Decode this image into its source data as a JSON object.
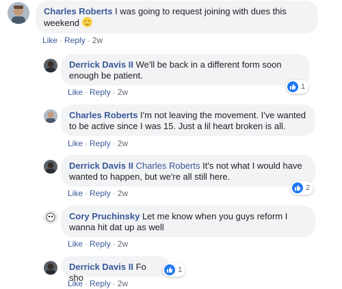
{
  "comments": [
    {
      "author": "Charles Roberts",
      "text": "I was going to request joining with dues this weekend",
      "emoji": "relieved-face-emoji",
      "like": "Like",
      "reply": "Reply",
      "time": "2w"
    },
    {
      "author": "Derrick Davis II",
      "text": "We'll be back in a different form soon enough be patient.",
      "like": "Like",
      "reply": "Reply",
      "time": "2w",
      "reactions": "1"
    },
    {
      "author": "Charles Roberts",
      "text": "I'm not leaving the movement. I've wanted to be active since I was 15. Just a lil heart broken is all.",
      "like": "Like",
      "reply": "Reply",
      "time": "2w"
    },
    {
      "author": "Derrick Davis II",
      "mention": "Charles Roberts",
      "text": "It's not what I would have wanted to happen, but we're all still here.",
      "like": "Like",
      "reply": "Reply",
      "time": "2w",
      "reactions": "2"
    },
    {
      "author": "Cory Pruchinsky",
      "text": "Let me know when you guys reform I wanna hit dat up as well",
      "like": "Like",
      "reply": "Reply",
      "time": "2w"
    },
    {
      "author": "Derrick Davis II",
      "text": "Fo sho",
      "like": "Like",
      "reply": "Reply",
      "time": "2w",
      "reactions": "1"
    }
  ],
  "colors": {
    "link": "#385898",
    "bubble": "#f2f3f5",
    "like_blue": "#2078f4"
  }
}
